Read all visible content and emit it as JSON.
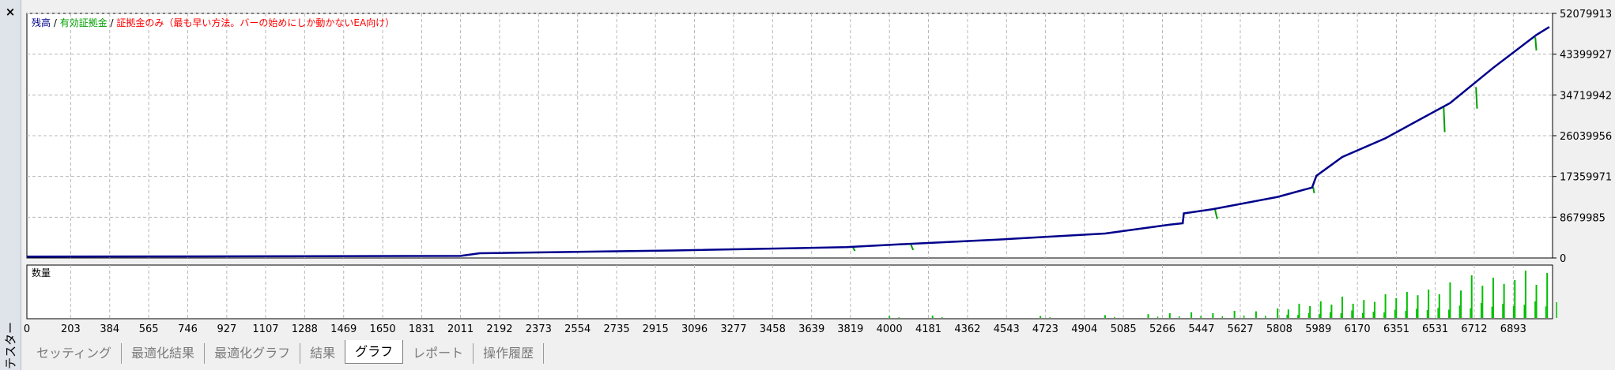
{
  "window": {
    "side_label": "テスター",
    "close_glyph": "×"
  },
  "tabs": [
    {
      "label": "セッティング",
      "active": false
    },
    {
      "label": "最適化結果",
      "active": false
    },
    {
      "label": "最適化グラフ",
      "active": false
    },
    {
      "label": "結果",
      "active": false
    },
    {
      "label": "グラフ",
      "active": true
    },
    {
      "label": "レポート",
      "active": false
    },
    {
      "label": "操作履歴",
      "active": false
    }
  ],
  "colors": {
    "balance": "#00008b",
    "equity": "#00a000",
    "margin": "#ff0000",
    "grid": "#b8b8b8",
    "volume": "#00c000"
  },
  "chart_data": [
    {
      "type": "line",
      "legend": [
        {
          "text": "残高",
          "color": "#00008b"
        },
        {
          "text": " / ",
          "color": "#000000"
        },
        {
          "text": "有効証拠金",
          "color": "#00a000"
        },
        {
          "text": " / ",
          "color": "#000000"
        },
        {
          "text": "証拠金のみ（最も早い方法。バーの始めにしか動かないEA向け）",
          "color": "#ff0000"
        }
      ],
      "legend_position": "top-left",
      "ylim": [
        0,
        52079913
      ],
      "y_ticks": [
        0,
        8679985,
        17359971,
        26039956,
        34719942,
        43399927,
        52079913
      ],
      "xlim": [
        0,
        7075
      ],
      "grid": true,
      "series": [
        {
          "name": "残高",
          "x": [
            0,
            1000,
            2011,
            2100,
            3000,
            3800,
            4000,
            4500,
            5000,
            5300,
            5360,
            5365,
            5500,
            5800,
            5960,
            5980,
            6100,
            6300,
            6600,
            6800,
            7000,
            7060
          ],
          "y": [
            300000,
            350000,
            450000,
            1000000,
            1600000,
            2300000,
            2800000,
            3900000,
            5200000,
            7100000,
            7400000,
            9500000,
            10400000,
            13000000,
            15000000,
            17500000,
            21500000,
            25500000,
            33000000,
            40500000,
            47500000,
            49200000
          ]
        },
        {
          "name": "有効証拠金",
          "x": [
            3830,
            3840,
            4100,
            4110,
            5510,
            5520,
            5965,
            5970,
            6570,
            6575,
            6720,
            6725,
            6995,
            7000
          ],
          "y": [
            2300000,
            1500000,
            2800000,
            1700000,
            10300000,
            8300000,
            15100000,
            13800000,
            32200000,
            26800000,
            36400000,
            31800000,
            47000000,
            44200000
          ]
        }
      ]
    },
    {
      "type": "bar",
      "title": "数量",
      "x_ticks": [
        0,
        203,
        384,
        565,
        746,
        927,
        1107,
        1288,
        1469,
        1650,
        1831,
        2011,
        2192,
        2373,
        2554,
        2735,
        2915,
        3096,
        3277,
        3458,
        3639,
        3819,
        4000,
        4181,
        4362,
        4543,
        4723,
        4904,
        5085,
        5266,
        5447,
        5627,
        5808,
        5989,
        6170,
        6351,
        6531,
        6712,
        6893
      ],
      "x": [
        4000,
        4200,
        4700,
        5000,
        5200,
        5300,
        5400,
        5500,
        5600,
        5700,
        5800,
        5850,
        5900,
        5950,
        6000,
        6050,
        6100,
        6150,
        6200,
        6250,
        6300,
        6350,
        6400,
        6450,
        6500,
        6550,
        6600,
        6650,
        6700,
        6750,
        6800,
        6850,
        6900,
        6950,
        7000,
        7050
      ],
      "values": [
        0.04,
        0.05,
        0.04,
        0.06,
        0.08,
        0.1,
        0.12,
        0.1,
        0.15,
        0.14,
        0.2,
        0.18,
        0.3,
        0.25,
        0.35,
        0.28,
        0.45,
        0.3,
        0.38,
        0.34,
        0.5,
        0.42,
        0.55,
        0.48,
        0.6,
        0.5,
        0.75,
        0.58,
        0.9,
        0.68,
        0.85,
        0.72,
        0.8,
        1.0,
        0.7,
        0.95
      ]
    }
  ]
}
